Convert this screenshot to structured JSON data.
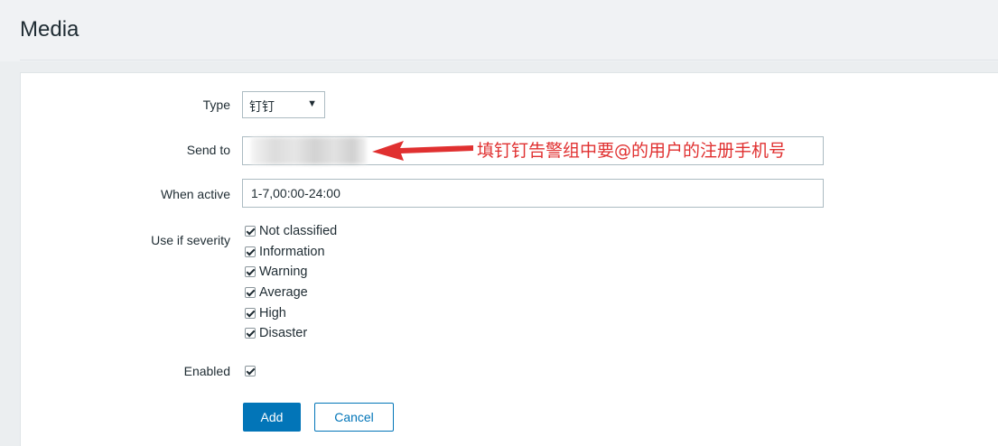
{
  "page": {
    "title": "Media"
  },
  "form": {
    "type": {
      "label": "Type",
      "value": "钉钉"
    },
    "send_to": {
      "label": "Send to",
      "value": ""
    },
    "when_active": {
      "label": "When active",
      "value": "1-7,00:00-24:00"
    },
    "severity": {
      "label": "Use if severity",
      "options": [
        {
          "label": "Not classified",
          "checked": true
        },
        {
          "label": "Information",
          "checked": true
        },
        {
          "label": "Warning",
          "checked": true
        },
        {
          "label": "Average",
          "checked": true
        },
        {
          "label": "High",
          "checked": true
        },
        {
          "label": "Disaster",
          "checked": true
        }
      ]
    },
    "enabled": {
      "label": "Enabled",
      "checked": true
    }
  },
  "buttons": {
    "add": "Add",
    "cancel": "Cancel"
  },
  "annotation": {
    "text": "填钉钉告警组中要@的用户的注册手机号",
    "color": "#e03030"
  },
  "colors": {
    "primary": "#0275b8",
    "background": "#ebeef0"
  }
}
